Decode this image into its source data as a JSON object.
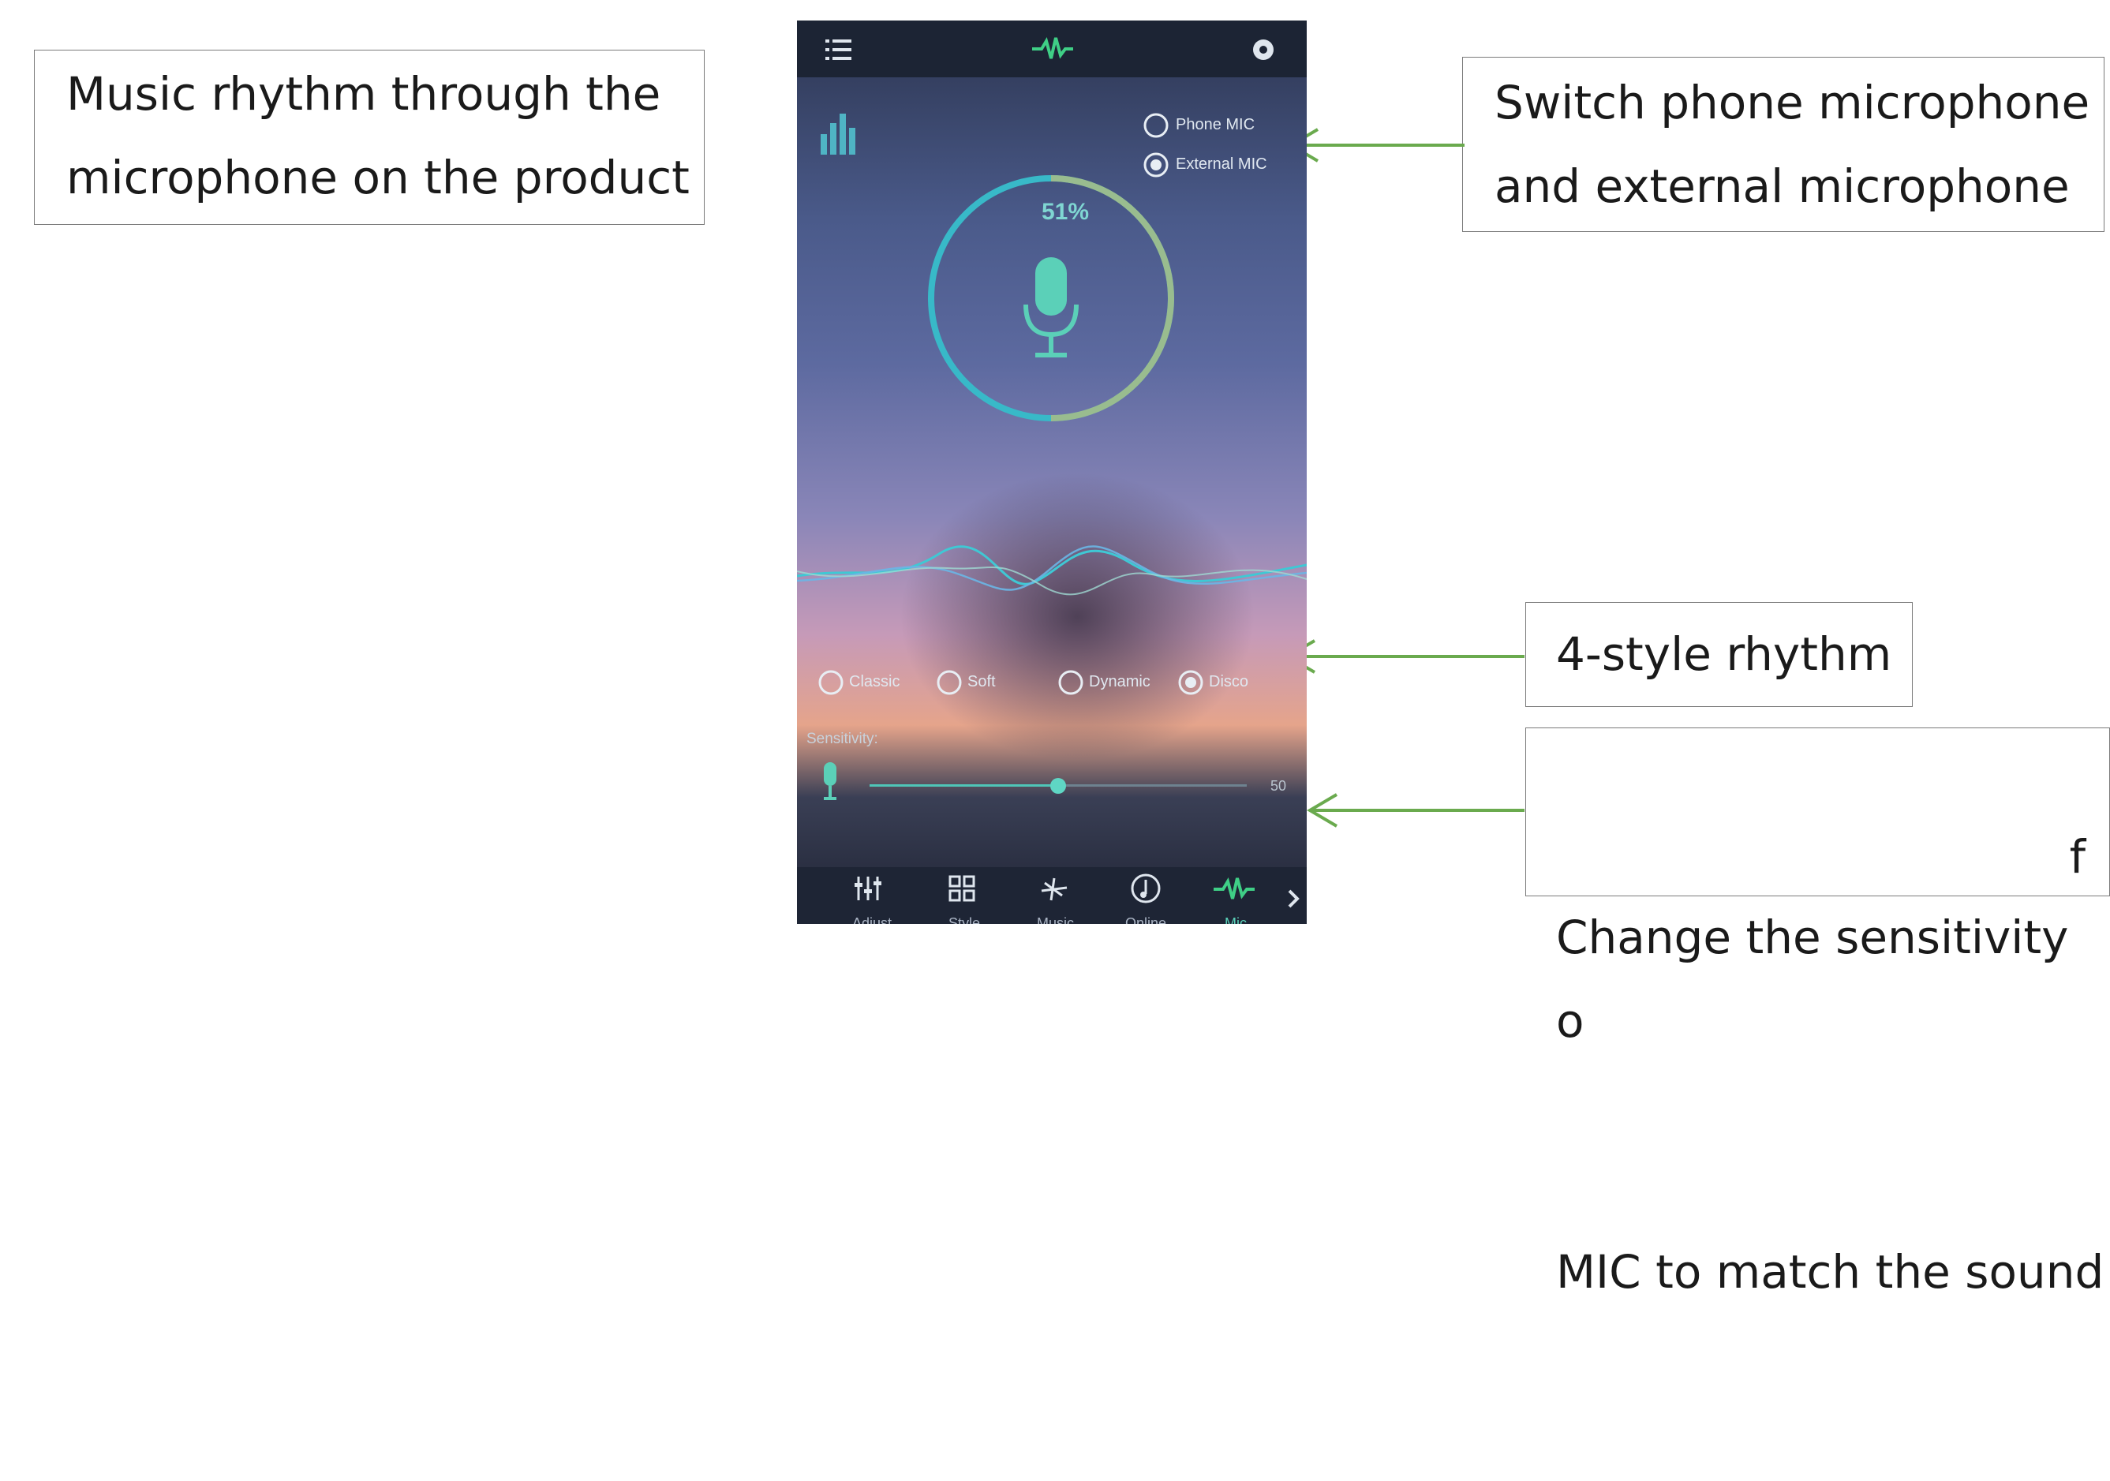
{
  "callouts": {
    "mic_rhythm": "Music rhythm through the\nmicrophone on the product",
    "switch_mic": "Switch phone microphone\nand external microphone",
    "styles": "4-style rhythm",
    "sensitivity_line1": "Change the sensitivity o",
    "sensitivity_line2": "MIC to match the sound",
    "sensitivity_tail": "f"
  },
  "app": {
    "mic_options": [
      "Phone MIC",
      "External MIC"
    ],
    "selected_mic": "External MIC",
    "level_percent": "51%",
    "styles": [
      "Classic",
      "Soft",
      "Dynamic",
      "Disco"
    ],
    "selected_style": "Disco",
    "sensitivity_label": "Sensitivity:",
    "sensitivity_value": "50",
    "sensitivity_fraction": 0.5,
    "nav": [
      "Adjust",
      "Style",
      "Music",
      "Online",
      "Mic"
    ],
    "active_nav": "Mic"
  },
  "colors": {
    "accent": "#49d0b8",
    "arrow": "#6aaa4e"
  }
}
